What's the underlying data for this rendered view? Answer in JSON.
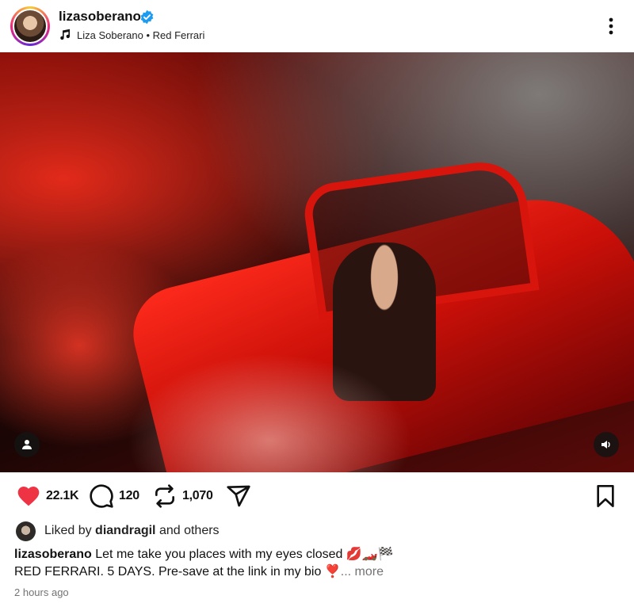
{
  "header": {
    "username": "lizasoberano",
    "music": "Liza Soberano • Red Ferrari"
  },
  "colors": {
    "like_red": "#ee3345",
    "verified_blue": "#1d9bf0",
    "muted_text": "#737373"
  },
  "icons": {
    "verified": "verified-badge-icon",
    "music": "music-note-icon",
    "more": "more-vertical-icon",
    "tag": "person-tag-icon",
    "audio": "speaker-icon",
    "like": "heart-icon",
    "comment": "comment-icon",
    "repost": "repost-icon",
    "share": "send-icon",
    "save": "bookmark-icon"
  },
  "actions": {
    "likes": "22.1K",
    "comments": "120",
    "reposts": "1,070"
  },
  "liked_by": {
    "prefix": "Liked by ",
    "user": "diandragil",
    "suffix": " and others"
  },
  "caption": {
    "user": "lizasoberano",
    "line1": " Let me take you places with my eyes closed 💋🏎️🏁",
    "line2": "RED FERRARI. 5 DAYS. Pre-save at the link in my bio ❣️",
    "ellipsis": "... ",
    "more": "more"
  },
  "timestamp": "2 hours ago"
}
